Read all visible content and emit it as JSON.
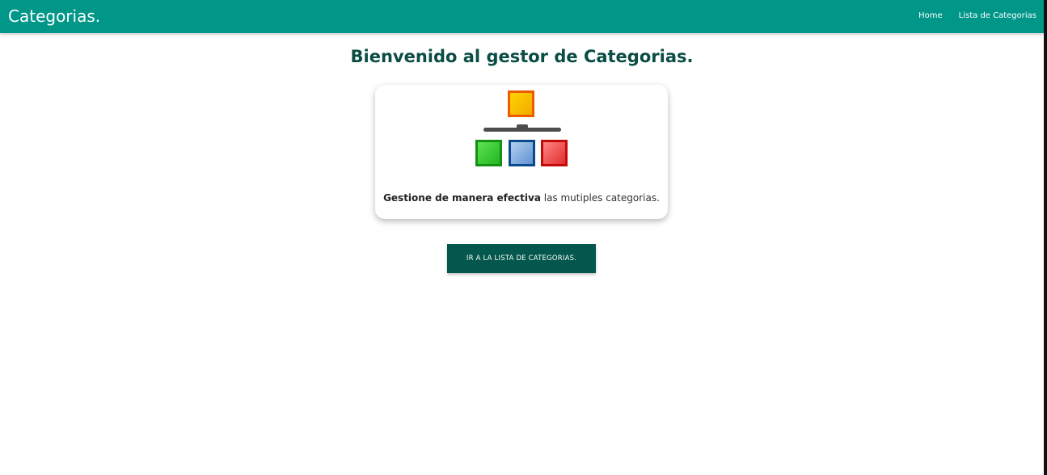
{
  "navbar": {
    "brand": "Categorias.",
    "links": [
      {
        "label": "Home"
      },
      {
        "label": "Lista de Categorias"
      }
    ],
    "color": "#009688"
  },
  "main": {
    "title": "Bienvenido al gestor de Categorias.",
    "card": {
      "icon": "category-hierarchy-icon",
      "text_bold": "Gestione de manera efectiva",
      "text_rest": " las mutiples categorias."
    },
    "button_label": "IR A LA LISTA DE CATEGORIAS."
  },
  "colors": {
    "primary": "#009688",
    "title": "#0b4d45",
    "button": "#03574c"
  }
}
